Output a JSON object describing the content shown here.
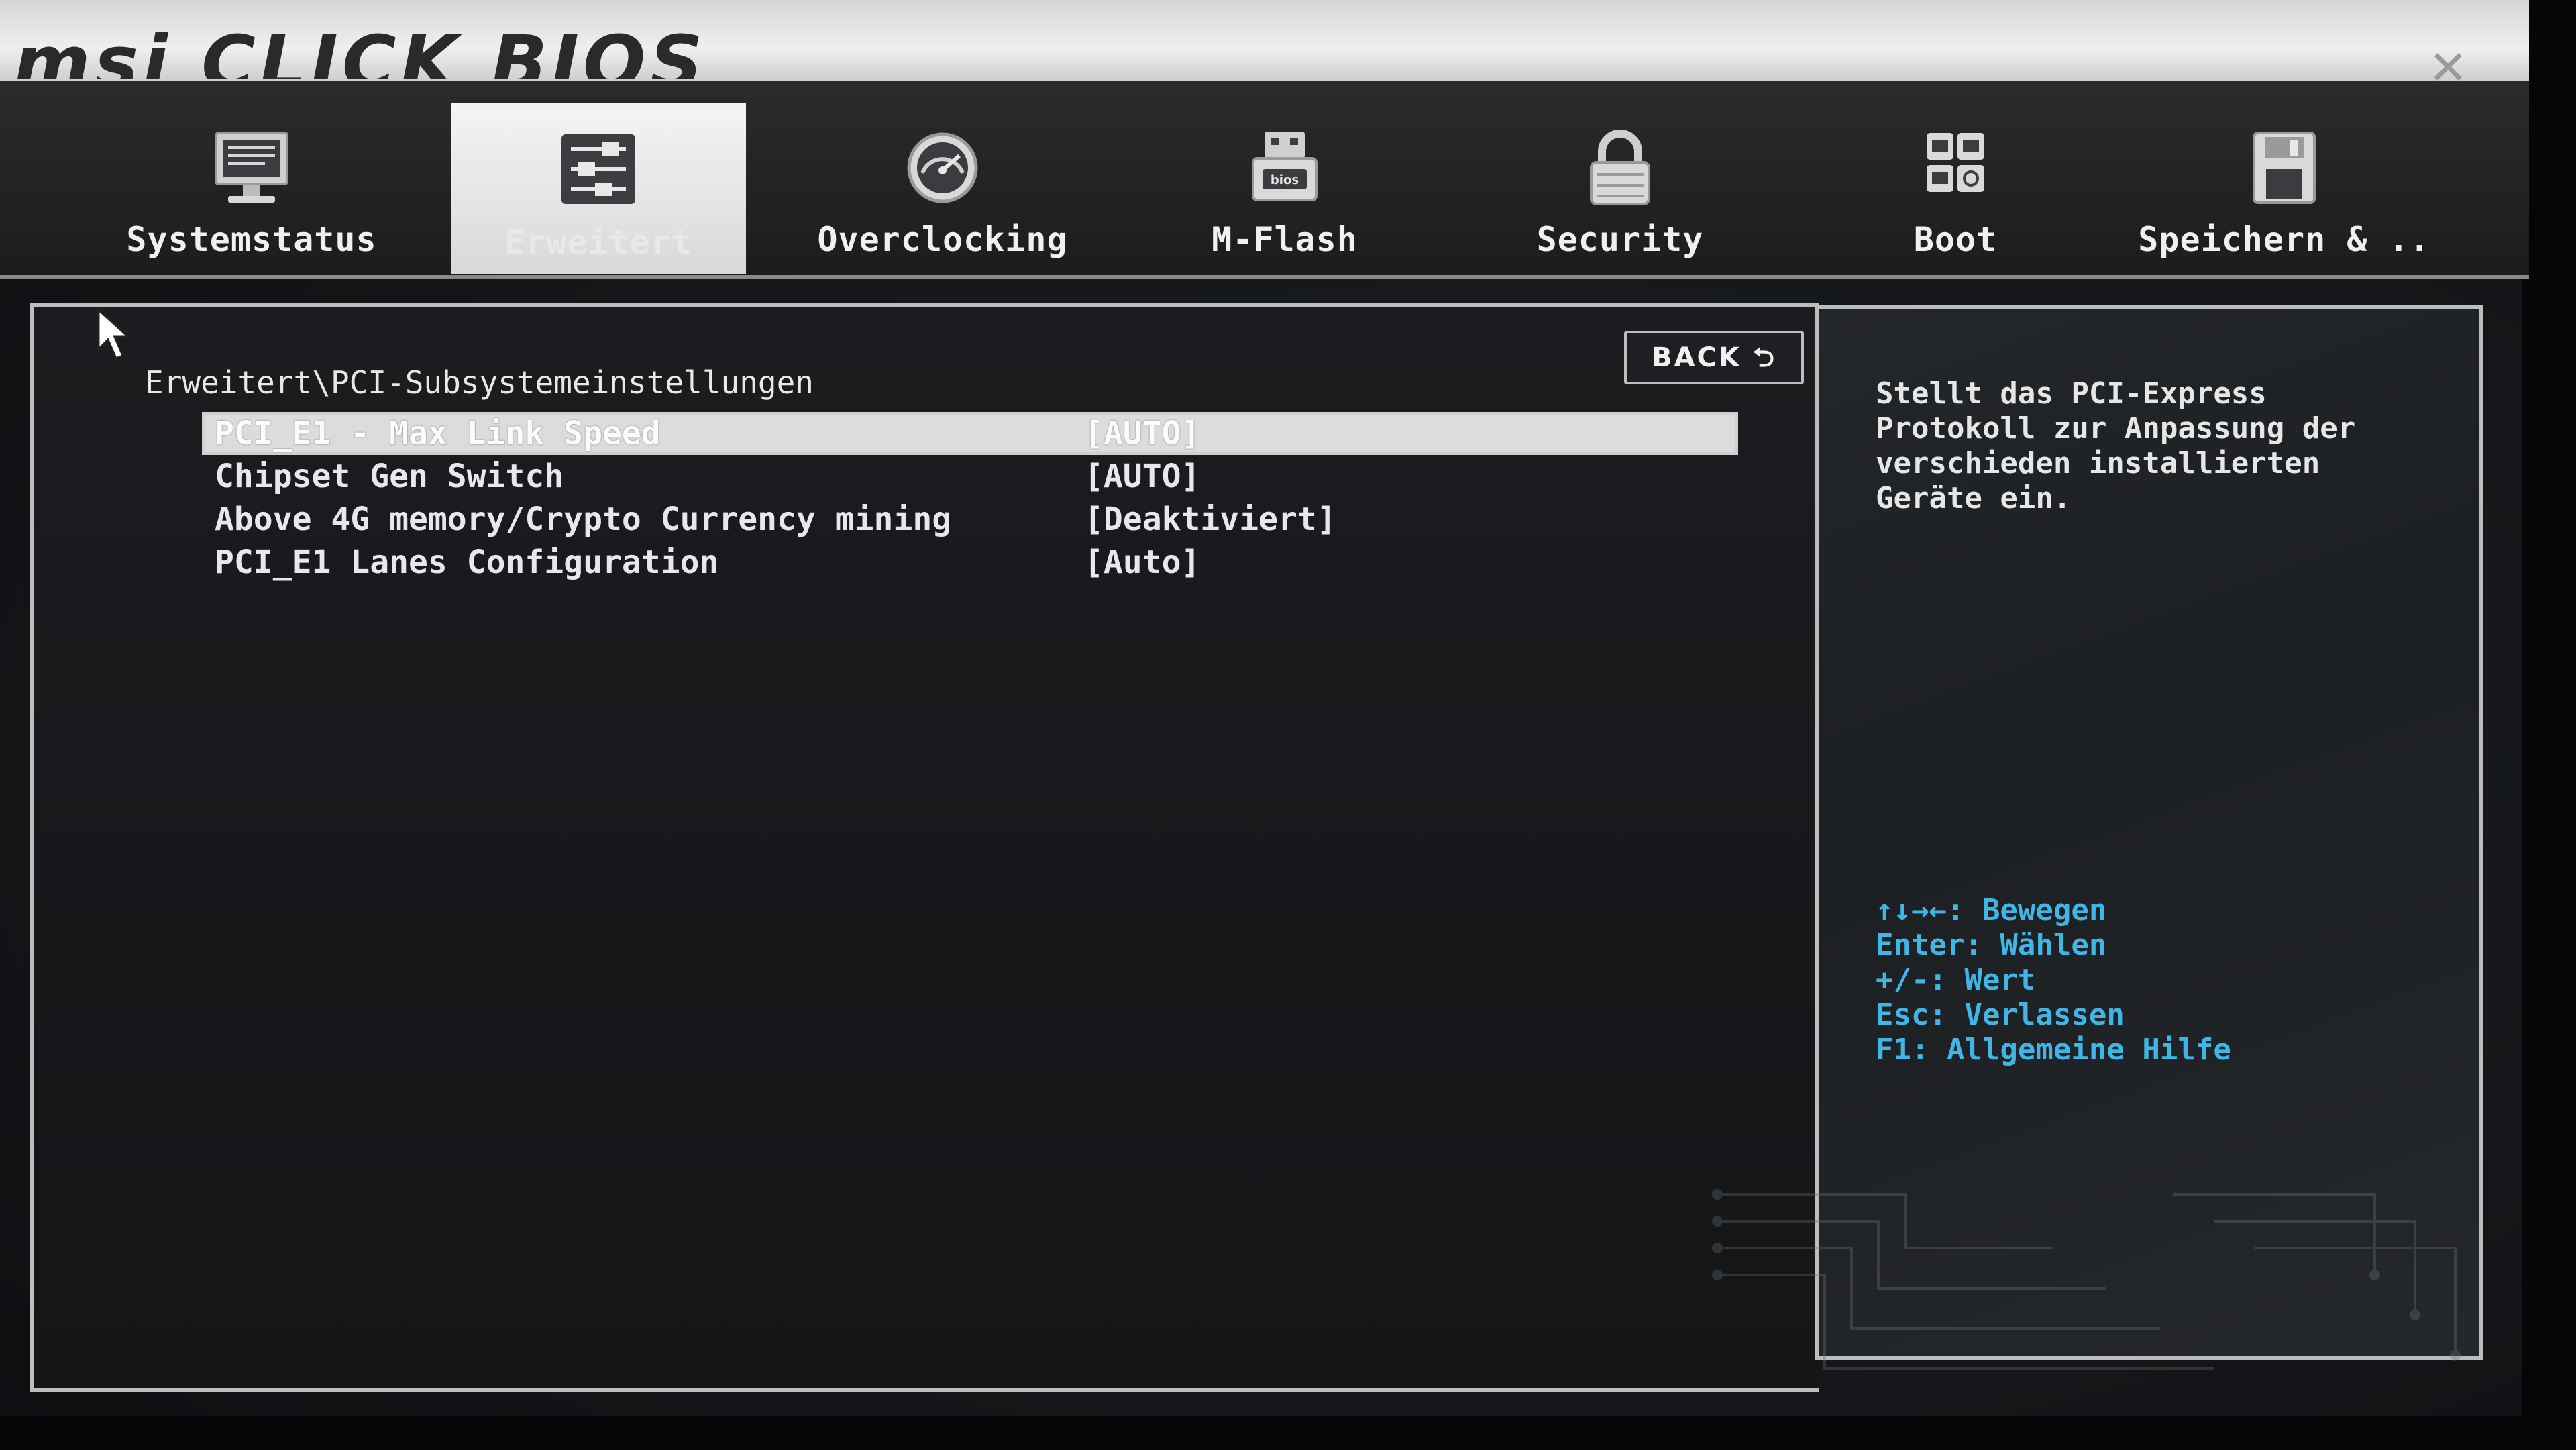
{
  "banner": {
    "logo_text": "msi CLICK BIOS",
    "close_icon": "close-icon"
  },
  "tabs": [
    {
      "label": "Systemstatus",
      "icon": "monitor-icon",
      "active": false
    },
    {
      "label": "Erweitert",
      "icon": "sliders-icon",
      "active": true
    },
    {
      "label": "Overclocking",
      "icon": "speedometer-icon",
      "active": false
    },
    {
      "label": "M-Flash",
      "icon": "usb-bios-icon",
      "active": false
    },
    {
      "label": "Security",
      "icon": "padlock-icon",
      "active": false
    },
    {
      "label": "Boot",
      "icon": "boot-grid-icon",
      "active": false
    },
    {
      "label": "Speichern & ..",
      "icon": "floppy-disk-icon",
      "active": false
    }
  ],
  "main": {
    "breadcrumb": "Erweitert\\PCI-Subsystemeinstellungen",
    "back_label": "BACK",
    "settings": [
      {
        "name": "PCI_E1 - Max Link Speed",
        "value": "[AUTO]",
        "selected": true
      },
      {
        "name": "Chipset Gen Switch",
        "value": "[AUTO]",
        "selected": false
      },
      {
        "name": "Above 4G memory/Crypto Currency mining",
        "value": "[Deaktiviert]",
        "selected": false
      },
      {
        "name": "PCI_E1 Lanes Configuration",
        "value": "[Auto]",
        "selected": false
      }
    ]
  },
  "help": {
    "description": "Stellt das PCI-Express\nProtokoll zur Anpassung der\nverschieden installierten\nGeräte ein.",
    "keys": [
      "↑↓→←: Bewegen",
      "Enter: Wählen",
      "+/-: Wert",
      "Esc: Verlassen",
      "F1: Allgemeine Hilfe"
    ]
  },
  "colors": {
    "key_help": "#3fb7e6",
    "panel_border": "#bdbdbd",
    "background": "#15171a"
  }
}
